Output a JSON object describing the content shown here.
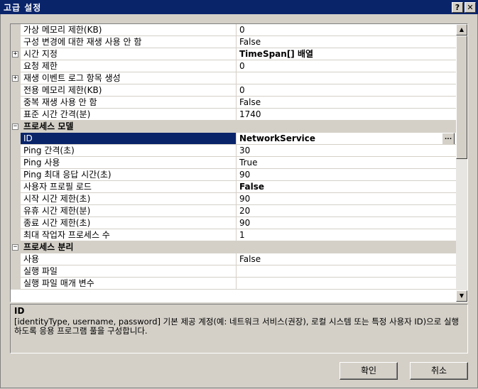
{
  "window": {
    "title": "고급 설정",
    "help_glyph": "?",
    "close_glyph": "✕"
  },
  "rows": [
    {
      "kind": "prop",
      "name": "가상 메모리 제한(KB)",
      "value": "0"
    },
    {
      "kind": "prop",
      "name": "구성 변경에 대한 재생 사용 안 함",
      "value": "False"
    },
    {
      "kind": "prop",
      "expander": "+",
      "name": "시간 지정",
      "value": "TimeSpan[] 배열",
      "value_bold": true
    },
    {
      "kind": "prop",
      "name": "요청 제한",
      "value": "0"
    },
    {
      "kind": "prop",
      "expander": "+",
      "name": "재생 이벤트 로그 항목 생성",
      "value": ""
    },
    {
      "kind": "prop",
      "name": "전용 메모리 제한(KB)",
      "value": "0"
    },
    {
      "kind": "prop",
      "name": "중복 재생 사용 안 함",
      "value": "False"
    },
    {
      "kind": "prop",
      "name": "표준 시간 간격(분)",
      "value": "1740"
    },
    {
      "kind": "category",
      "expander": "−",
      "name": "프로세스 모델"
    },
    {
      "kind": "prop",
      "name": "ID",
      "value": "NetworkService",
      "value_bold": true,
      "selected": true,
      "button": "..."
    },
    {
      "kind": "prop",
      "name": "Ping 간격(초)",
      "value": "30"
    },
    {
      "kind": "prop",
      "name": "Ping 사용",
      "value": "True"
    },
    {
      "kind": "prop",
      "name": "Ping 최대 응답 시간(초)",
      "value": "90"
    },
    {
      "kind": "prop",
      "name": "사용자 프로필 로드",
      "value": "False",
      "value_bold": true
    },
    {
      "kind": "prop",
      "name": "시작 시간 제한(초)",
      "value": "90"
    },
    {
      "kind": "prop",
      "name": "유휴 시간 제한(분)",
      "value": "20"
    },
    {
      "kind": "prop",
      "name": "종료 시간 제한(초)",
      "value": "90"
    },
    {
      "kind": "prop",
      "name": "최대 작업자 프로세스 수",
      "value": "1"
    },
    {
      "kind": "category",
      "expander": "−",
      "name": "프로세스 분리"
    },
    {
      "kind": "prop",
      "name": "사용",
      "value": "False"
    },
    {
      "kind": "prop",
      "name": "실행 파일",
      "value": ""
    },
    {
      "kind": "prop",
      "name": "실행 파일 매개 변수",
      "value": ""
    }
  ],
  "scrollbar": {
    "up_glyph": "▲",
    "down_glyph": "▼"
  },
  "description": {
    "title": "ID",
    "text": "[identityType, username, password] 기본 제공 계정(예: 네트워크 서비스(권장), 로컬 시스템 또는 특정 사용자 ID)으로 실행하도록 응용 프로그램 풀을 구성합니다."
  },
  "buttons": {
    "ok": "확인",
    "cancel": "취소"
  }
}
